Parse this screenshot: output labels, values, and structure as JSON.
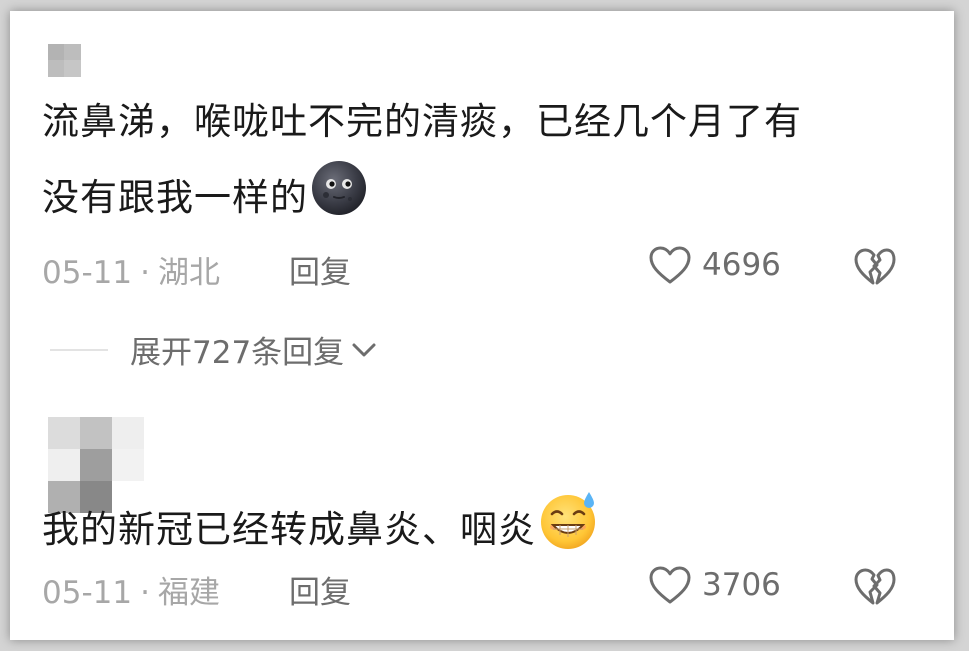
{
  "comments": [
    {
      "text_line1": "流鼻涕，喉咙吐不完的清痰，已经几个月了有",
      "text_line2": "没有跟我一样的",
      "emoji": "new-moon-face-emoji",
      "date": "05-11",
      "separator": "·",
      "location": "湖北",
      "reply_label": "回复",
      "likes": "4696"
    },
    {
      "text_line1": "我的新冠已经转成鼻炎、咽炎",
      "emoji": "grinning-sweat-emoji",
      "date": "05-11",
      "separator": "·",
      "location": "福建",
      "reply_label": "回复",
      "likes": "3706"
    }
  ],
  "expand_replies": {
    "label": "展开727条回复",
    "icon": "chevron-down-icon"
  },
  "icons": {
    "like": "heart-outline-icon",
    "dislike": "broken-heart-icon"
  },
  "colors": {
    "text": "#1a1a1a",
    "meta": "#a7a7a7",
    "action": "#6d6d6d",
    "background": "#ffffff"
  }
}
